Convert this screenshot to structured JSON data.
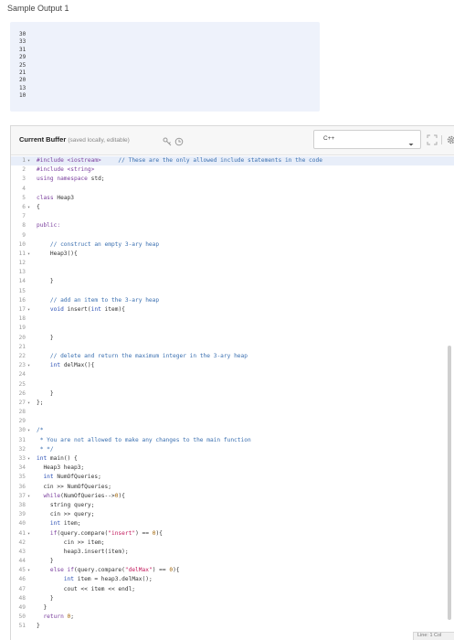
{
  "sample": {
    "title": "Sample Output 1",
    "lines": [
      "30",
      "33",
      "31",
      "29",
      "25",
      "21",
      "20",
      "13",
      "10"
    ]
  },
  "editor": {
    "title": "Current Buffer",
    "note": "(saved locally, editable)",
    "language": "C++",
    "status": "Line: 1 Col"
  },
  "code": [
    {
      "n": "1",
      "fold": true,
      "hl": true,
      "segs": [
        [
          "pp",
          "#include <iostream>"
        ],
        [
          "",
          "     "
        ],
        [
          "cm",
          "// These are the only allowed include statements in the code"
        ]
      ]
    },
    {
      "n": "2",
      "segs": [
        [
          "pp",
          "#include <string>"
        ]
      ]
    },
    {
      "n": "3",
      "segs": [
        [
          "kw",
          "using namespace"
        ],
        [
          "",
          " std;"
        ]
      ]
    },
    {
      "n": "4",
      "segs": []
    },
    {
      "n": "5",
      "segs": [
        [
          "kw",
          "class"
        ],
        [
          "",
          " Heap3"
        ]
      ]
    },
    {
      "n": "6",
      "fold": true,
      "segs": [
        [
          "",
          "{"
        ]
      ]
    },
    {
      "n": "7",
      "segs": []
    },
    {
      "n": "8",
      "segs": [
        [
          "kw",
          "public:"
        ]
      ]
    },
    {
      "n": "9",
      "segs": []
    },
    {
      "n": "10",
      "segs": [
        [
          "",
          "    "
        ],
        [
          "cm",
          "// construct an empty 3-ary heap"
        ]
      ]
    },
    {
      "n": "11",
      "fold": true,
      "segs": [
        [
          "",
          "    Heap3(){"
        ]
      ]
    },
    {
      "n": "12",
      "segs": []
    },
    {
      "n": "13",
      "segs": []
    },
    {
      "n": "14",
      "segs": [
        [
          "",
          "    }"
        ]
      ]
    },
    {
      "n": "15",
      "segs": []
    },
    {
      "n": "16",
      "segs": [
        [
          "",
          "    "
        ],
        [
          "cm",
          "// add an item to the 3-ary heap"
        ]
      ]
    },
    {
      "n": "17",
      "fold": true,
      "segs": [
        [
          "",
          "    "
        ],
        [
          "ty",
          "void"
        ],
        [
          "",
          " insert("
        ],
        [
          "ty",
          "int"
        ],
        [
          "",
          " item){"
        ]
      ]
    },
    {
      "n": "18",
      "segs": []
    },
    {
      "n": "19",
      "segs": []
    },
    {
      "n": "20",
      "segs": [
        [
          "",
          "    }"
        ]
      ]
    },
    {
      "n": "21",
      "segs": []
    },
    {
      "n": "22",
      "segs": [
        [
          "",
          "    "
        ],
        [
          "cm",
          "// delete and return the maximum integer in the 3-ary heap"
        ]
      ]
    },
    {
      "n": "23",
      "fold": true,
      "segs": [
        [
          "",
          "    "
        ],
        [
          "ty",
          "int"
        ],
        [
          "",
          " delMax(){"
        ]
      ]
    },
    {
      "n": "24",
      "segs": []
    },
    {
      "n": "25",
      "segs": []
    },
    {
      "n": "26",
      "segs": [
        [
          "",
          "    }"
        ]
      ]
    },
    {
      "n": "27",
      "fold": true,
      "segs": [
        [
          "",
          "};"
        ]
      ]
    },
    {
      "n": "28",
      "segs": []
    },
    {
      "n": "29",
      "segs": []
    },
    {
      "n": "30",
      "fold": true,
      "segs": [
        [
          "cm",
          "/*"
        ]
      ]
    },
    {
      "n": "31",
      "segs": [
        [
          "cm",
          " * You are not allowed to make any changes to the main function"
        ]
      ]
    },
    {
      "n": "32",
      "segs": [
        [
          "cm",
          " * */"
        ]
      ]
    },
    {
      "n": "33",
      "fold": true,
      "segs": [
        [
          "ty",
          "int"
        ],
        [
          "",
          " main() {"
        ]
      ]
    },
    {
      "n": "34",
      "segs": [
        [
          "",
          "  Heap3 heap3;"
        ]
      ]
    },
    {
      "n": "35",
      "segs": [
        [
          "",
          "  "
        ],
        [
          "ty",
          "int"
        ],
        [
          "",
          " NumOfQueries;"
        ]
      ]
    },
    {
      "n": "36",
      "segs": [
        [
          "",
          "  cin >> NumOfQueries;"
        ]
      ]
    },
    {
      "n": "37",
      "fold": true,
      "segs": [
        [
          "",
          "  "
        ],
        [
          "kw",
          "while"
        ],
        [
          "",
          "(NumOfQueries-->"
        ],
        [
          "nu",
          "0"
        ],
        [
          "",
          "){"
        ]
      ]
    },
    {
      "n": "38",
      "segs": [
        [
          "",
          "    string query;"
        ]
      ]
    },
    {
      "n": "39",
      "segs": [
        [
          "",
          "    cin >> query;"
        ]
      ]
    },
    {
      "n": "40",
      "segs": [
        [
          "",
          "    "
        ],
        [
          "ty",
          "int"
        ],
        [
          "",
          " item;"
        ]
      ]
    },
    {
      "n": "41",
      "fold": true,
      "segs": [
        [
          "",
          "    "
        ],
        [
          "kw",
          "if"
        ],
        [
          "",
          "(query.compare("
        ],
        [
          "st",
          "\"insert\""
        ],
        [
          "",
          ") == "
        ],
        [
          "nu",
          "0"
        ],
        [
          "",
          "){"
        ]
      ]
    },
    {
      "n": "42",
      "segs": [
        [
          "",
          "        cin >> item;"
        ]
      ]
    },
    {
      "n": "43",
      "segs": [
        [
          "",
          "        heap3.insert(item);"
        ]
      ]
    },
    {
      "n": "44",
      "segs": [
        [
          "",
          "    }"
        ]
      ]
    },
    {
      "n": "45",
      "fold": true,
      "segs": [
        [
          "",
          "    "
        ],
        [
          "kw",
          "else if"
        ],
        [
          "",
          "(query.compare("
        ],
        [
          "st",
          "\"delMax\""
        ],
        [
          "",
          ") == "
        ],
        [
          "nu",
          "0"
        ],
        [
          "",
          "){"
        ]
      ]
    },
    {
      "n": "46",
      "segs": [
        [
          "",
          "        "
        ],
        [
          "ty",
          "int"
        ],
        [
          "",
          " item = heap3.delMax();"
        ]
      ]
    },
    {
      "n": "47",
      "segs": [
        [
          "",
          "        cout << item << endl;"
        ]
      ]
    },
    {
      "n": "48",
      "segs": [
        [
          "",
          "    }"
        ]
      ]
    },
    {
      "n": "49",
      "segs": [
        [
          "",
          "  }"
        ]
      ]
    },
    {
      "n": "50",
      "segs": [
        [
          "",
          "  "
        ],
        [
          "kw",
          "return"
        ],
        [
          "",
          " "
        ],
        [
          "nu",
          "0"
        ],
        [
          "",
          ";"
        ]
      ]
    },
    {
      "n": "51",
      "segs": [
        [
          "",
          "}"
        ]
      ]
    }
  ]
}
